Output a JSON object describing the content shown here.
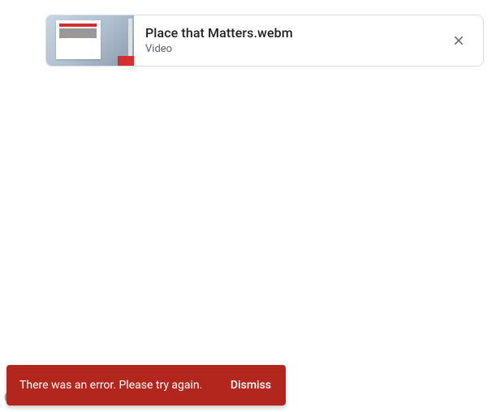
{
  "file": {
    "title": "Place that Matters.webm",
    "subtitle": "Video"
  },
  "snackbar": {
    "message": "There was an error. Please try again.",
    "action": "Dismiss"
  }
}
